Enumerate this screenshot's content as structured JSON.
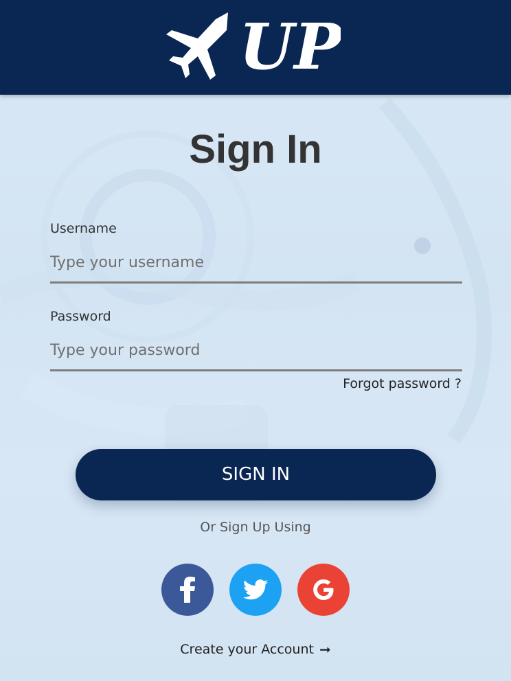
{
  "header": {
    "logo_text": "UP",
    "background_color": "#0a2652"
  },
  "form": {
    "title": "Sign In",
    "username": {
      "label": "Username",
      "placeholder": "Type your username",
      "value": ""
    },
    "password": {
      "label": "Password",
      "placeholder": "Type your password",
      "value": ""
    },
    "forgot_password": "Forgot password ?",
    "submit_label": "SIGN IN"
  },
  "alternate": {
    "or_text": "Or Sign Up Using",
    "social": [
      {
        "icon": "facebook-icon",
        "color": "#3b5998"
      },
      {
        "icon": "twitter-icon",
        "color": "#1da1f2"
      },
      {
        "icon": "google-icon",
        "color": "#ea4335"
      }
    ],
    "create_account": "Create your Account",
    "create_account_icon": "arrow-right-icon"
  }
}
